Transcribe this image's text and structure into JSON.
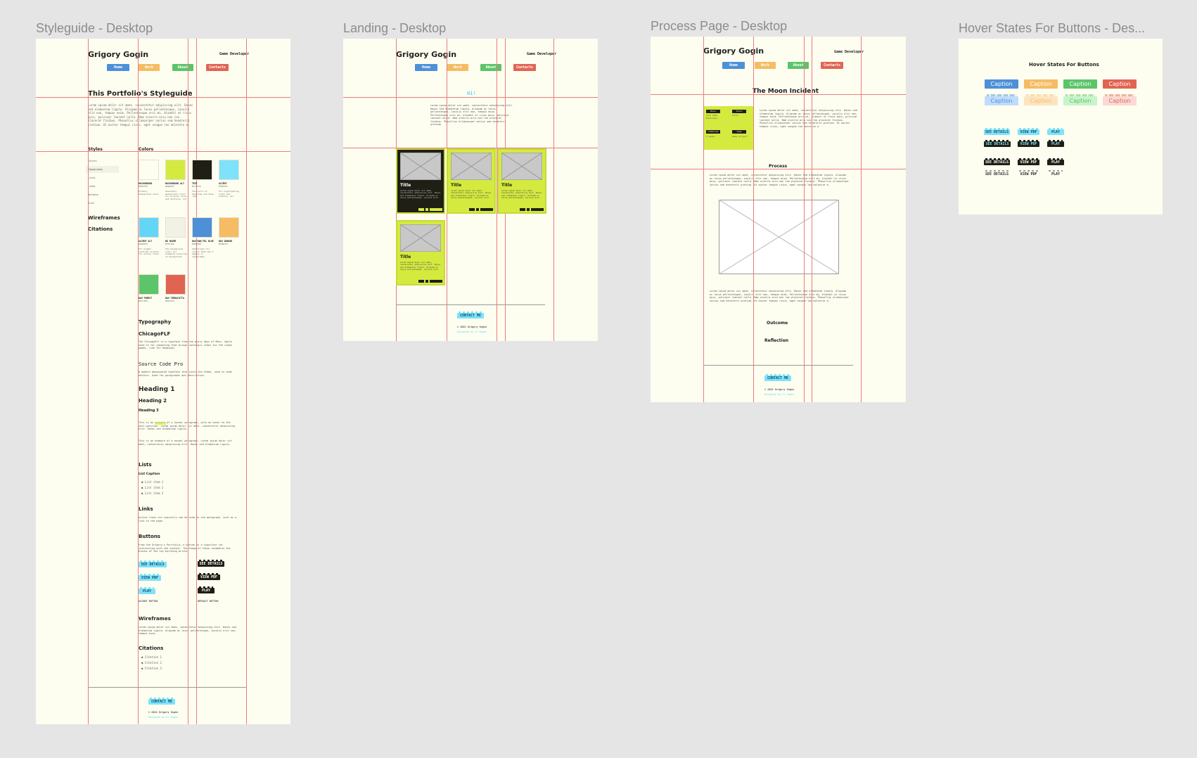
{
  "frames": {
    "styleguide": "Styleguide - Desktop",
    "landing": "Landing - Desktop",
    "process": "Process Page - Desktop",
    "hover": "Hover States For Buttons - Des..."
  },
  "site": {
    "brand": "Grigory Gogin",
    "role": "Game Developer",
    "nav": [
      "Home",
      "Work",
      "About",
      "Contacts"
    ],
    "contact": "CONTACT ME",
    "copyright": "© 2022 Grigory Gogin",
    "footer_link": "Designed by Gr Gogin"
  },
  "colors": {
    "home": "#4d90d8",
    "work": "#f5bc63",
    "about": "#5cc469",
    "contacts": "#e16452",
    "accent": "#d4ea3f",
    "dark": "#1f1f16",
    "cyan": "#7ee2fa"
  },
  "styleguide": {
    "title": "This Portfolio's Styleguide",
    "intro": "Lorem ipsum dolor sit amet, consectetur adipiscing elit. Donec sed elementum ligula. Aliquam ac lacus pellentesque, iaculis elit non, tempus enim. Pellentesque orci mi, blandit ut risus quis, pulvinar laoreet nulla. Nam viverra arcu non leo placerat finibus. Phasellus ullamcorper varius sem hendrerit pretium. Ut auctor tempus risus, eget congue leo molestie a.",
    "sidebar": {
      "styles": "Styles",
      "items": [
        "Colors",
        "Typography",
        "Lists",
        "Links",
        "Buttons",
        "Grid"
      ],
      "wireframes": "Wireframes",
      "citations": "Citations"
    },
    "colors_heading": "Colors",
    "swatches": [
      {
        "name": "BACKGROUND",
        "hex": "#fdfef0",
        "sub": "#FEFFED",
        "desc": "Primary background color"
      },
      {
        "name": "BACKGROUND ALT",
        "hex": "#d4ea3f",
        "sub": "#D4EB3F",
        "desc": "Secondary background color for project cards and sections, etc"
      },
      {
        "name": "TEXT",
        "hex": "#1f1f16",
        "sub": "#1F1F16",
        "desc": "The color of headings and body copy"
      },
      {
        "name": "ACCENT",
        "hex": "#7ee2fa",
        "sub": "#7EE2FA",
        "desc": "For highlighting links and buttons, etc"
      },
      {
        "name": "ACCENT ALT",
        "hex": "#63d6f8",
        "sub": "#63D6F8",
        "desc": "For higher contrast accents for active links"
      },
      {
        "name": "BG HOVER",
        "hex": "#f1f1e5",
        "sub": "#F1F1E5",
        "desc": "The background color for elements hovering on background"
      },
      {
        "name": "NAV BAR/TEL BLUE",
        "hex": "#4d90d8",
        "sub": "#4D90D8",
        "desc": "Additional for colors that don't appear in typography"
      },
      {
        "name": "NAV ORANGE",
        "hex": "#f5bc63",
        "sub": "#F5BC63",
        "desc": ""
      },
      {
        "name": "NAV FOREST",
        "hex": "#5cc469",
        "sub": "#5CC469",
        "desc": ""
      },
      {
        "name": "NAV TERRACOTTA",
        "hex": "#e16452",
        "sub": "#E16452",
        "desc": ""
      }
    ],
    "typography": "Typography",
    "font1": "ChicagoFLF",
    "font1_desc": "The ChicagoFLF is a typeface from the glory days of Macs. Apple used it for computing that brings nostalgic vibes for the video games, like for headings.",
    "font2": "Source Code Pro",
    "font2_desc": "A modern monospaced typeface that suits the theme, used in code editors. Used for paragraphs and description.",
    "heading1": "Heading 1",
    "heading2": "Heading 2",
    "heading3": "Heading 3",
    "para1": "This is an example of a normal paragraph, with an hover to the next position. Lorem ipsum dolor sit amet, consectetur adipiscing elit. Donec sed elementum ligula.",
    "para2": "This is an example of a normal paragraph. Lorem ipsum dolor sit amet, consectetur adipiscing elit. Donec sed elementum ligula.",
    "lists": "Lists",
    "list_caption": "List Caption",
    "list_items": [
      "List item 1",
      "List item 2",
      "List item 3"
    ],
    "links": "Links",
    "links_desc": "Active links are typically can be used in the paragraph, such as a link to the page.",
    "buttons": "Buttons",
    "buttons_desc": "From the Grigory's Portfolio, a button is a signifier for interacting with the content. The shape of these resembles the blocks of the toy building bricks.",
    "btn_see": "SEE DETAILS",
    "btn_pdf": "VIEW PDF",
    "btn_play": "PLAY",
    "accent_label": "ACCENT BUTTON",
    "default_label": "DEFAULT BUTTON",
    "wireframes": "Wireframes",
    "wireframes_desc": "Lorem ipsum dolor sit amet, consectetur adipiscing elit. Donec sed elementum ligula. Aliquam ac lacus pellentesque, iaculis elit non, tempus enim.",
    "citations": "Citations",
    "citation_items": [
      "Citation 1",
      "Citation 2",
      "Citation 3"
    ]
  },
  "landing": {
    "hi": "Hi!",
    "intro": "Lorem ipsum dolor sit amet, consectetur adipiscing elit. Donec sed elementum ligula. Aliquam ac lacus pellentesque, iaculis elit non, tempus enim. Pellentesque orci mi, blandit ut risus quis, pulvinar laoreet nulla. Nam viverra arcu non leo placerat finibus. Phasellus ullamcorper varius sem hendrerit pretium.",
    "card_title": "Title",
    "card_text": "Lorem ipsum dolor sit amet, consectetur adipiscing elit. Donec sed elementum ligula. Aliquam ac lacus pellentesque, iaculis elit."
  },
  "process": {
    "title": "The Moon Incident",
    "meta": [
      {
        "label": "Role",
        "value": "Solo Game Developer"
      },
      {
        "label": "Tools",
        "value": "Unity"
      },
      {
        "label": "Timeline",
        "value": "2 weeks"
      },
      {
        "label": "Type",
        "value": "Game project"
      }
    ],
    "intro": "Lorem ipsum dolor sit amet, consectetur adipiscing elit. Donec sed elementum ligula. Aliquam ac lacus pellentesque, iaculis elit non, tempus enim. Pellentesque orci mi, blandit ut risus quis, pulvinar laoreet nulla. Nam viverra arcu non leo placerat finibus. Phasellus ullamcorper varius sem hendrerit pretium. Ut auctor tempus risus, eget congue leo molestie a.",
    "process": "Process",
    "process_text": "Lorem ipsum dolor sit amet, consectetur adipiscing elit. Donec sed elementum ligula. Aliquam ac lacus pellentesque, iaculis elit non, tempus enim. Pellentesque orci mi, blandit ut risus quis, pulvinar laoreet nulla. Nam viverra arcu non leo placerat finibus. Phasellus ullamcorper varius sem hendrerit pretium. Ut auctor tempus risus, eget congue leo molestie a.",
    "after_text": "Lorem ipsum dolor sit amet, consectetur adipiscing elit. Donec sed elementum ligula. Aliquam ac lacus pellentesque, iaculis elit non, tempus enim. Pellentesque orci mi, blandit ut risus quis, pulvinar laoreet nulla. Nam viverra arcu non leo placerat finibus. Phasellus ullamcorper varius sem hendrerit pretium. Ut auctor tempus risus, eget congue leo molestie a.",
    "outcome": "Outcome",
    "reflection": "Reflection"
  },
  "hover": {
    "title": "Hover States For Buttons",
    "caption": "Caption",
    "btn_see": "SEE DETAILS",
    "btn_pdf": "VIEW PDF",
    "btn_play": "PLAY"
  }
}
